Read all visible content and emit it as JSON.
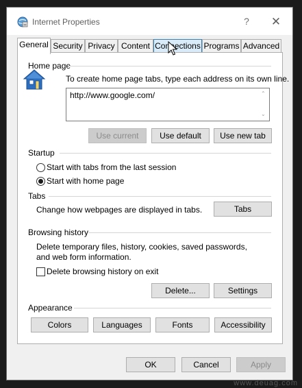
{
  "window": {
    "title": "Internet Properties",
    "help_label": "?",
    "close_label": "✕"
  },
  "tabs": [
    {
      "label": "General",
      "state": "active"
    },
    {
      "label": "Security",
      "state": "normal"
    },
    {
      "label": "Privacy",
      "state": "normal"
    },
    {
      "label": "Content",
      "state": "normal"
    },
    {
      "label": "Connections",
      "state": "hover"
    },
    {
      "label": "Programs",
      "state": "normal"
    },
    {
      "label": "Advanced",
      "state": "normal"
    }
  ],
  "home_page": {
    "heading": "Home page",
    "description": "To create home page tabs, type each address on its own line.",
    "url": "http://www.google.com/",
    "use_current": "Use current",
    "use_default": "Use default",
    "use_new_tab": "Use new tab"
  },
  "startup": {
    "heading": "Startup",
    "option_last_session": "Start with tabs from the last session",
    "option_home_page": "Start with home page",
    "selected": "home_page"
  },
  "tabs_section": {
    "heading": "Tabs",
    "description": "Change how webpages are displayed in tabs.",
    "button": "Tabs"
  },
  "browsing_history": {
    "heading": "Browsing history",
    "description": "Delete temporary files, history, cookies, saved passwords, and web form information.",
    "delete_on_exit": "Delete browsing history on exit",
    "delete_on_exit_checked": false,
    "delete_button": "Delete...",
    "settings_button": "Settings"
  },
  "appearance": {
    "heading": "Appearance",
    "colors": "Colors",
    "languages": "Languages",
    "fonts": "Fonts",
    "accessibility": "Accessibility"
  },
  "dialog_buttons": {
    "ok": "OK",
    "cancel": "Cancel",
    "apply": "Apply"
  },
  "watermark": "www.deuag.com",
  "colors": {
    "hover_tab_bg": "#d9ebf9",
    "hover_tab_border": "#3c7fb1",
    "icon_blue": "#2c6fc1"
  }
}
